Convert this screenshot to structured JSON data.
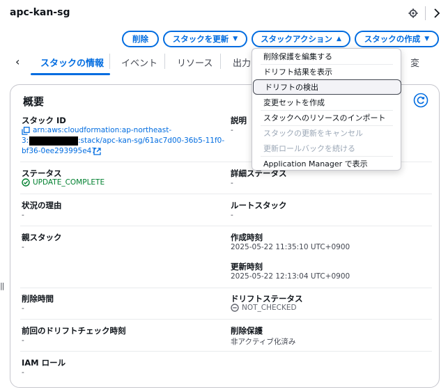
{
  "header": {
    "stack_name": "apc-kan-sg"
  },
  "toolbar": {
    "delete_label": "削除",
    "update_label": "スタックを更新",
    "actions_label": "スタックアクション",
    "create_label": "スタックの作成"
  },
  "tabs": [
    {
      "label": "スタックの情報"
    },
    {
      "label": "イベント"
    },
    {
      "label": "リソース"
    },
    {
      "label": "出力"
    },
    {
      "label": "変"
    }
  ],
  "overview": {
    "title": "概要",
    "stack_id": {
      "label": "スタック ID",
      "line1": "arn:aws:cloudformation:ap-northeast-",
      "line2_prefix": "3:",
      "line2_suffix": ":stack/apc-kan-sg/61ac7d00-36b5-11f0-",
      "line3": "bf36-0ee293995e47"
    },
    "description": {
      "label": "説明",
      "value": "-"
    },
    "status": {
      "label": "ステータス",
      "value": "UPDATE_COMPLETE"
    },
    "detailed_status": {
      "label": "詳細ステータス",
      "value": "-"
    },
    "status_reason": {
      "label": "状況の理由",
      "value": "-"
    },
    "root_stack": {
      "label": "ルートスタック",
      "value": "-"
    },
    "parent_stack": {
      "label": "親スタック",
      "value": "-"
    },
    "created_time": {
      "label": "作成時刻",
      "value": "2025-05-22 11:35:10 UTC+0900"
    },
    "updated_time": {
      "label": "更新時刻",
      "value": "2025-05-22 12:13:04 UTC+0900"
    },
    "deleted_time": {
      "label": "削除時間",
      "value": "-"
    },
    "drift_status": {
      "label": "ドリフトステータス",
      "value": "NOT_CHECKED"
    },
    "last_drift_check": {
      "label": "前回のドリフトチェック時刻",
      "value": "-"
    },
    "termination_protection": {
      "label": "削除保護",
      "value": "非アクティブ化済み"
    },
    "iam_role": {
      "label": "IAM ロール",
      "value": "-"
    }
  },
  "actions_menu": {
    "items": [
      {
        "label": "削除保護を編集する",
        "disabled": false
      },
      {
        "label": "ドリフト結果を表示",
        "disabled": false
      },
      {
        "label": "ドリフトの検出",
        "disabled": false,
        "hover": true
      },
      {
        "label": "変更セットを作成",
        "disabled": false
      },
      {
        "label": "スタックへのリソースのインポート",
        "disabled": false
      },
      {
        "label": "スタックの更新をキャンセル",
        "disabled": true
      },
      {
        "label": "更新ロールバックを続ける",
        "disabled": true
      },
      {
        "label": "Application Manager で表示",
        "disabled": false
      }
    ]
  },
  "colors": {
    "accent": "#006ce0",
    "success": "#00802f",
    "text": "#0f141a",
    "muted": "#424650"
  }
}
